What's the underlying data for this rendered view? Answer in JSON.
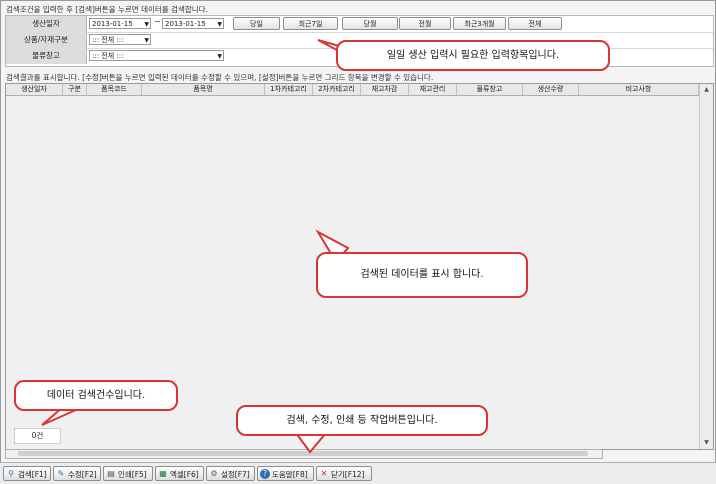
{
  "top_info": "검색조건을 입력한 후 [검색]버튼을 누르면 데이터를 검색합니다.",
  "form": {
    "date_label": "생산일자",
    "date_from": "2013-01-15",
    "date_sep": "~",
    "date_to": "2013-01-15",
    "period_buttons": [
      "당일",
      "최근7일",
      "당월",
      "전월",
      "최근3개월",
      "전체"
    ],
    "category_label": "상품/자재구분",
    "category_value": "::: 전체 :::",
    "warehouse_label": "물류창고",
    "warehouse_value": "::: 전체 :::"
  },
  "result_info": "검색결과를 표시합니다. [수정]버튼을 누르면 입력된 데이터를 수정할 수 있으며, [설정]버튼을 누르면 그리드 항목을 변경할 수 있습니다.",
  "grid": {
    "columns": [
      "생산일자",
      "구분",
      "품목코드",
      "품목명",
      "1차카테고리",
      "2차카테고리",
      "재고차감",
      "재고관리",
      "물류창고",
      "생산수량",
      "비고사항"
    ]
  },
  "record_count": "0건",
  "bottom_buttons": [
    {
      "label": "검색[F1]",
      "icon": "search-icon"
    },
    {
      "label": "수정[F2]",
      "icon": "edit-icon"
    },
    {
      "label": "인쇄[F5]",
      "icon": "print-icon"
    },
    {
      "label": "엑셀[F6]",
      "icon": "excel-icon"
    },
    {
      "label": "설정[F7]",
      "icon": "gear-icon"
    },
    {
      "label": "도움말[F8]",
      "icon": "help-icon"
    },
    {
      "label": "닫기[F12]",
      "icon": "close-icon"
    }
  ],
  "callouts": {
    "input": "일일 생산 입력시 필요한 입력항목입니다.",
    "data": "검색된 데이터를 표시 합니다.",
    "count": "데이터 검색건수입니다.",
    "buttons": "검색, 수정, 인쇄  등 작업버튼입니다."
  }
}
